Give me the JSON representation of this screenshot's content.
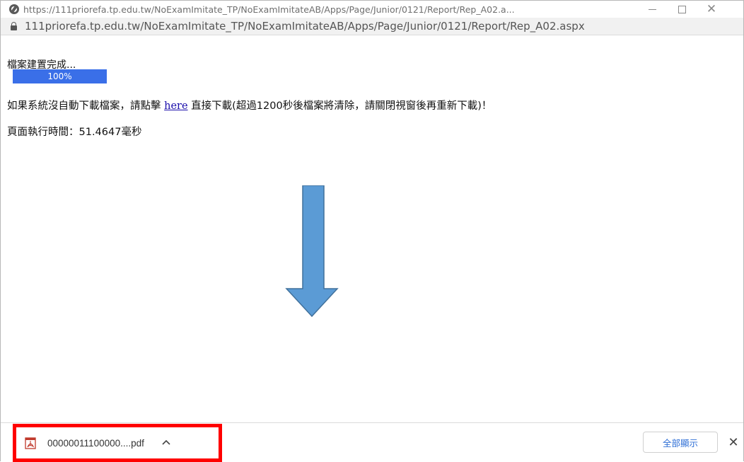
{
  "window": {
    "title": "https://111priorefa.tp.edu.tw/NoExamImitate_TP/NoExamImitateAB/Apps/Page/Junior/0121/Report/Rep_A02.a...",
    "minimize_glyph": "",
    "maximize_glyph": "",
    "close_glyph": "✕"
  },
  "address_bar": {
    "url": "111priorefa.tp.edu.tw/NoExamImitate_TP/NoExamImitateAB/Apps/Page/Junior/0121/Report/Rep_A02.aspx",
    "icon": "lock-icon"
  },
  "content": {
    "status": "檔案建置完成...",
    "progress": {
      "label": "100%",
      "value": 1.0,
      "color": "#3a6fe8"
    },
    "notice_before": "如果系統沒自動下載檔案，請點擊 ",
    "notice_link": "here",
    "notice_after": " 直接下載(超過1200秒後檔案將清除，請關閉視窗後再重新下載)！",
    "exec_time": "頁面執行時間：51.4647毫秒"
  },
  "annotation": {
    "arrow_color": "#5b9bd5",
    "arrow_direction": "down",
    "highlight_color": "#ff0000"
  },
  "download_shelf": {
    "file_name": "00000011100000....pdf",
    "file_icon": "pdf-icon",
    "show_all_label": "全部顯示",
    "close_glyph": "✕"
  }
}
